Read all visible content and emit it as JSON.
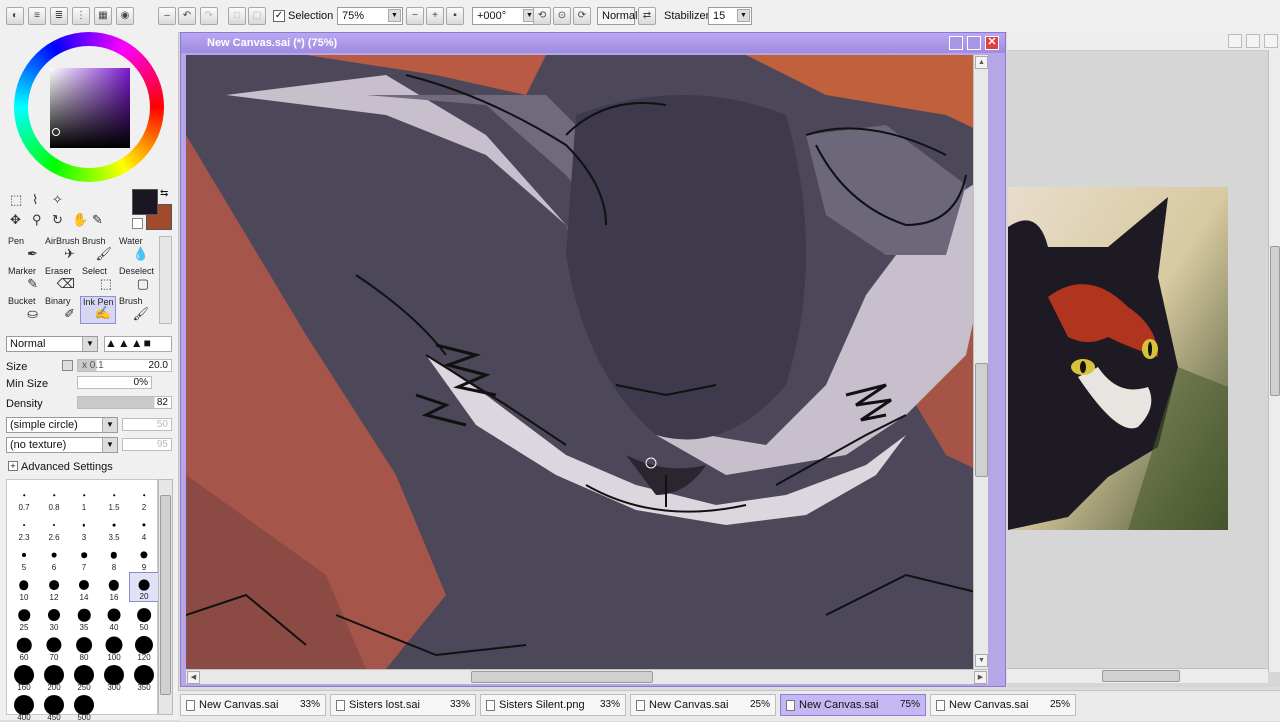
{
  "toolbar": {
    "selection_label": "Selection",
    "selection_checked": true,
    "zoom": "75%",
    "rotation": "+000°",
    "blend_mode": "Normal",
    "stabilizer_label": "Stabilizer",
    "stabilizer_value": "15"
  },
  "color": {
    "primary": "#1a1622",
    "secondary": "#a44a2c"
  },
  "tools": [
    {
      "label": "Pen",
      "icon": "pen-icon"
    },
    {
      "label": "AirBrush",
      "icon": "airbrush-icon"
    },
    {
      "label": "Brush",
      "icon": "brush-icon"
    },
    {
      "label": "Water",
      "icon": "water-icon"
    },
    {
      "label": "Marker",
      "icon": "marker-icon"
    },
    {
      "label": "Eraser",
      "icon": "eraser-icon"
    },
    {
      "label": "Select",
      "icon": "select-icon"
    },
    {
      "label": "Deselect",
      "icon": "deselect-icon"
    },
    {
      "label": "Bucket",
      "icon": "bucket-icon"
    },
    {
      "label": "Binary",
      "icon": "binary-icon"
    },
    {
      "label": "Ink Pen",
      "icon": "inkpen-icon",
      "selected": true
    },
    {
      "label": "Brush",
      "icon": "brush-icon"
    }
  ],
  "brush": {
    "mode": "Normal",
    "size_label": "Size",
    "size_multiplier": "x 0.1",
    "size_value": "20.0",
    "min_size_label": "Min Size",
    "min_size_value": "0%",
    "density_label": "Density",
    "density_value": "82",
    "shape": "(simple circle)",
    "shape_value": "50",
    "texture": "(no texture)",
    "texture_value": "95",
    "advanced_label": "Advanced Settings"
  },
  "brush_sizes": [
    "0.7",
    "0.8",
    "1",
    "1.5",
    "2",
    "2.3",
    "2.6",
    "3",
    "3.5",
    "4",
    "5",
    "6",
    "7",
    "8",
    "9",
    "10",
    "12",
    "14",
    "16",
    "20",
    "25",
    "30",
    "35",
    "40",
    "50",
    "60",
    "70",
    "80",
    "100",
    "120",
    "160",
    "200",
    "250",
    "300",
    "350",
    "400",
    "450",
    "500"
  ],
  "selected_brush_size": "20",
  "window": {
    "title": "New Canvas.sai (*) (75%)"
  },
  "tabs": [
    {
      "name": "New Canvas.sai",
      "pct": "33%"
    },
    {
      "name": "Sisters lost.sai",
      "pct": "33%"
    },
    {
      "name": "Sisters Silent.png",
      "pct": "33%"
    },
    {
      "name": "New Canvas.sai",
      "pct": "25%"
    },
    {
      "name": "New Canvas.sai",
      "pct": "75%",
      "active": true
    },
    {
      "name": "New Canvas.sai",
      "pct": "25%"
    }
  ]
}
